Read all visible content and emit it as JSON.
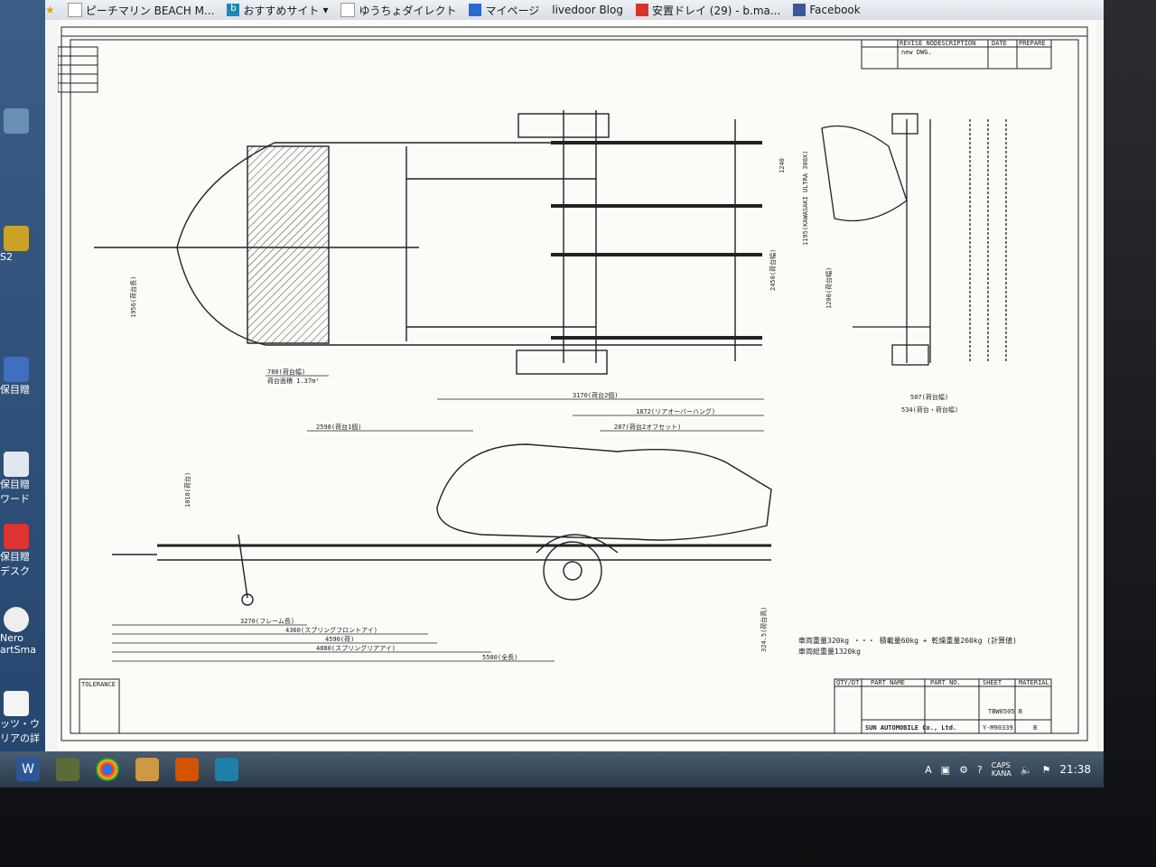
{
  "favorites": [
    {
      "label": "ピーチマリン BEACH M...",
      "icon": "page-icon"
    },
    {
      "label": "おすすめサイト",
      "icon": "bing-icon",
      "has_dropdown": true
    },
    {
      "label": "ゆうちょダイレクト",
      "icon": "page-icon"
    },
    {
      "label": "マイページ",
      "icon": "myblog-icon"
    },
    {
      "label": "livedoor Blog",
      "icon": "page-icon"
    },
    {
      "label": "安置ドレイ (29) - b.ma...",
      "icon": "gallery-icon"
    },
    {
      "label": "Facebook",
      "icon": "facebook-icon"
    }
  ],
  "desktop_icons": [
    {
      "label": "S2",
      "icon": "app-icon"
    },
    {
      "label": "保目贈",
      "icon": "folder-icon"
    },
    {
      "label": "保目贈\nワード",
      "icon": "word-icon"
    },
    {
      "label": "保目贈\nデスク",
      "icon": "pdf-icon"
    },
    {
      "label": "Nero\nartSma",
      "icon": "nero-icon"
    },
    {
      "label": "ッツ・ウ\nリアの詳",
      "icon": "document-icon"
    }
  ],
  "drawing": {
    "revision_table": {
      "headers": [
        "REVISE NO.",
        "DESCRIPTION",
        "DATE",
        "PREPARE"
      ],
      "rows": [
        [
          "",
          "new DWG.",
          "",
          ""
        ]
      ]
    },
    "top_view_dims": {
      "width_780": "780(荷台幅)",
      "bed_area": "荷台面積 1.37m²",
      "width_1956": "1956(荷台長)",
      "width_2450": "2450(荷台幅)",
      "width_1240": "1240"
    },
    "end_view_dims": {
      "d_1195": "1195(KAWASAKI ULTRA 300X)",
      "d_1200": "1200(荷台幅)",
      "d_507": "507(荷台幅)",
      "d_534": "534(荷台・荷台幅)"
    },
    "side_view_dims": {
      "d_3170": "3170(荷台2個)",
      "d_1872": "1872(リアオーバーハング)",
      "d_2598": "2598(荷台1個)",
      "d_287": "287(荷台2オフセット)",
      "d_1018": "1018(荷台)",
      "d_3270": "3270(フレーム長)",
      "d_4360": "4360(スプリングフロントアイ)",
      "d_4590": "4590(荷)",
      "d_4880": "4880(スプリングリアアイ)",
      "d_5500": "5500(全長)",
      "d_324": "324.5(荷台高)"
    },
    "weight_notes": [
      "車両重量320kg ・・・ 積載量60kg + 乾燥重量260kg (計算値)",
      "車両総重量1320kg"
    ],
    "title_block": {
      "headers": [
        "QTY/DT",
        "PART NAME",
        "PART NO.",
        "SHEET",
        "MATERIAL"
      ],
      "drawing_no": "TBW0505 B",
      "company": "SUN AUTOMOBILE Co., Ltd.",
      "drawing_id": "Y-M90339",
      "rev": "B"
    },
    "tolerance_label": "TOLERANCE"
  },
  "taskbar": {
    "apps": [
      "word-app",
      "photo-app",
      "chrome-app",
      "paint-app",
      "office-app",
      "tool-app"
    ],
    "tray_text": "CAPS\nKANA",
    "clock": "21:38"
  }
}
